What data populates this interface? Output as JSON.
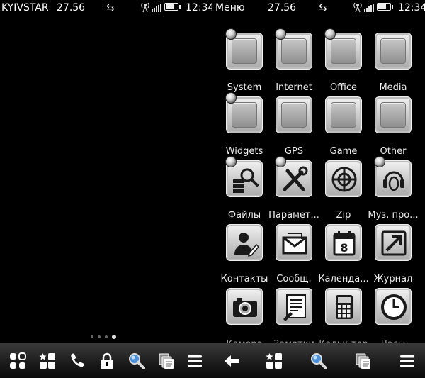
{
  "left_screen": {
    "status": {
      "operator": "KYIVSTAR",
      "battery_value": "27.56",
      "time": "12:34"
    },
    "page_dots": {
      "count": 4,
      "active": 3
    },
    "taskbar": [
      "apps-grid-icon",
      "favorites-icon",
      "phone-icon",
      "lock-icon",
      "search-icon",
      "tasks-icon",
      "menu-icon"
    ]
  },
  "right_screen": {
    "status": {
      "title": "Меню",
      "battery_value": "27.56",
      "time": "12:34"
    },
    "items": [
      {
        "label": "System",
        "icon": "folder-icon",
        "badge": true
      },
      {
        "label": "Internet",
        "icon": "folder-icon",
        "badge": true
      },
      {
        "label": "Office",
        "icon": "folder-icon",
        "badge": true
      },
      {
        "label": "Media",
        "icon": "folder-icon",
        "badge": false
      },
      {
        "label": "Widgets",
        "icon": "folder-icon",
        "badge": true
      },
      {
        "label": "GPS",
        "icon": "folder-icon",
        "badge": false
      },
      {
        "label": "Game",
        "icon": "folder-icon",
        "badge": false
      },
      {
        "label": "Other",
        "icon": "folder-icon",
        "badge": false
      },
      {
        "label": "Файлы",
        "icon": "file-manager-icon",
        "badge": true
      },
      {
        "label": "Парамет...",
        "icon": "tools-icon",
        "badge": true
      },
      {
        "label": "Zip",
        "icon": "zip-icon",
        "badge": false
      },
      {
        "label": "Муз. про...",
        "icon": "music-player-icon",
        "badge": true
      },
      {
        "label": "Контакты",
        "icon": "contacts-icon",
        "badge": false
      },
      {
        "label": "Сообщ.",
        "icon": "messages-icon",
        "badge": false
      },
      {
        "label": "Календа...",
        "icon": "calendar-icon",
        "badge": false
      },
      {
        "label": "Журнал",
        "icon": "log-icon",
        "badge": false
      },
      {
        "label": "Камера",
        "icon": "camera-icon",
        "badge": false
      },
      {
        "label": "Заметки",
        "icon": "notes-icon",
        "badge": false
      },
      {
        "label": "Кальк-тор",
        "icon": "calculator-icon",
        "badge": false
      },
      {
        "label": "Часы",
        "icon": "clock-icon",
        "badge": false
      }
    ],
    "calendar_day": "8",
    "taskbar": [
      "back-arrow-icon",
      "favorites-icon",
      "search-icon",
      "tasks-icon",
      "menu-icon"
    ]
  }
}
